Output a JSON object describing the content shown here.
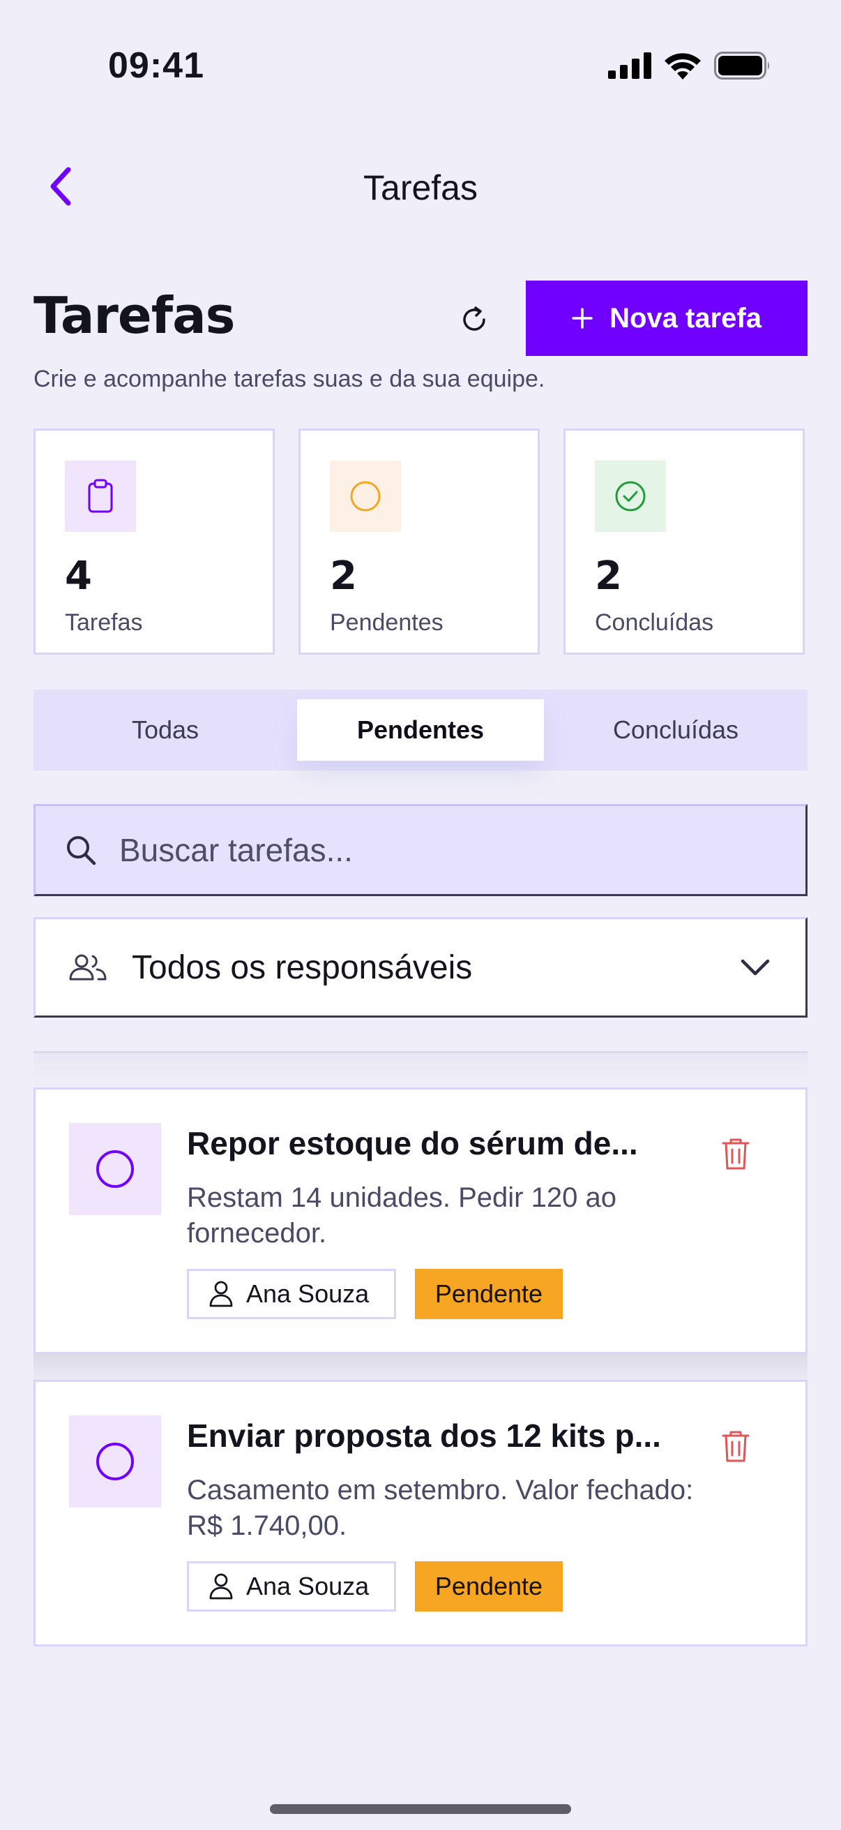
{
  "status_bar": {
    "time": "09:41"
  },
  "nav": {
    "title": "Tarefas"
  },
  "header": {
    "title": "Tarefas",
    "new_button_label": "Nova tarefa",
    "subtitle": "Crie e acompanhe tarefas suas e da sua equipe."
  },
  "stats": [
    {
      "value": "4",
      "label": "Tarefas",
      "icon": "clipboard-icon",
      "color": "#7000ff",
      "bg": "#f1e4fd"
    },
    {
      "value": "2",
      "label": "Pendentes",
      "icon": "circle-icon",
      "color": "#f6a623",
      "bg": "#fdf0e4"
    },
    {
      "value": "2",
      "label": "Concluídas",
      "icon": "check-circle-icon",
      "color": "#1e9e3a",
      "bg": "#e4f5e8"
    }
  ],
  "tabs": [
    {
      "label": "Todas",
      "active": false
    },
    {
      "label": "Pendentes",
      "active": true
    },
    {
      "label": "Concluídas",
      "active": false
    }
  ],
  "search": {
    "placeholder": "Buscar tarefas...",
    "value": ""
  },
  "assignee_filter": {
    "selected": "Todos os responsáveis"
  },
  "tasks": [
    {
      "title": "Repor estoque do sérum de...",
      "description": "Restam 14 unidades. Pedir 120 ao fornecedor.",
      "assignee": "Ana Souza",
      "status": "Pendente"
    },
    {
      "title": "Enviar proposta dos 12 kits p...",
      "description": "Casamento em setembro. Valor fechado: R$ 1.740,00.",
      "assignee": "Ana Souza",
      "status": "Pendente"
    }
  ],
  "colors": {
    "accent": "#7000ff",
    "pending": "#f6a623",
    "delete": "#e05555",
    "background": "#f0eff9"
  }
}
